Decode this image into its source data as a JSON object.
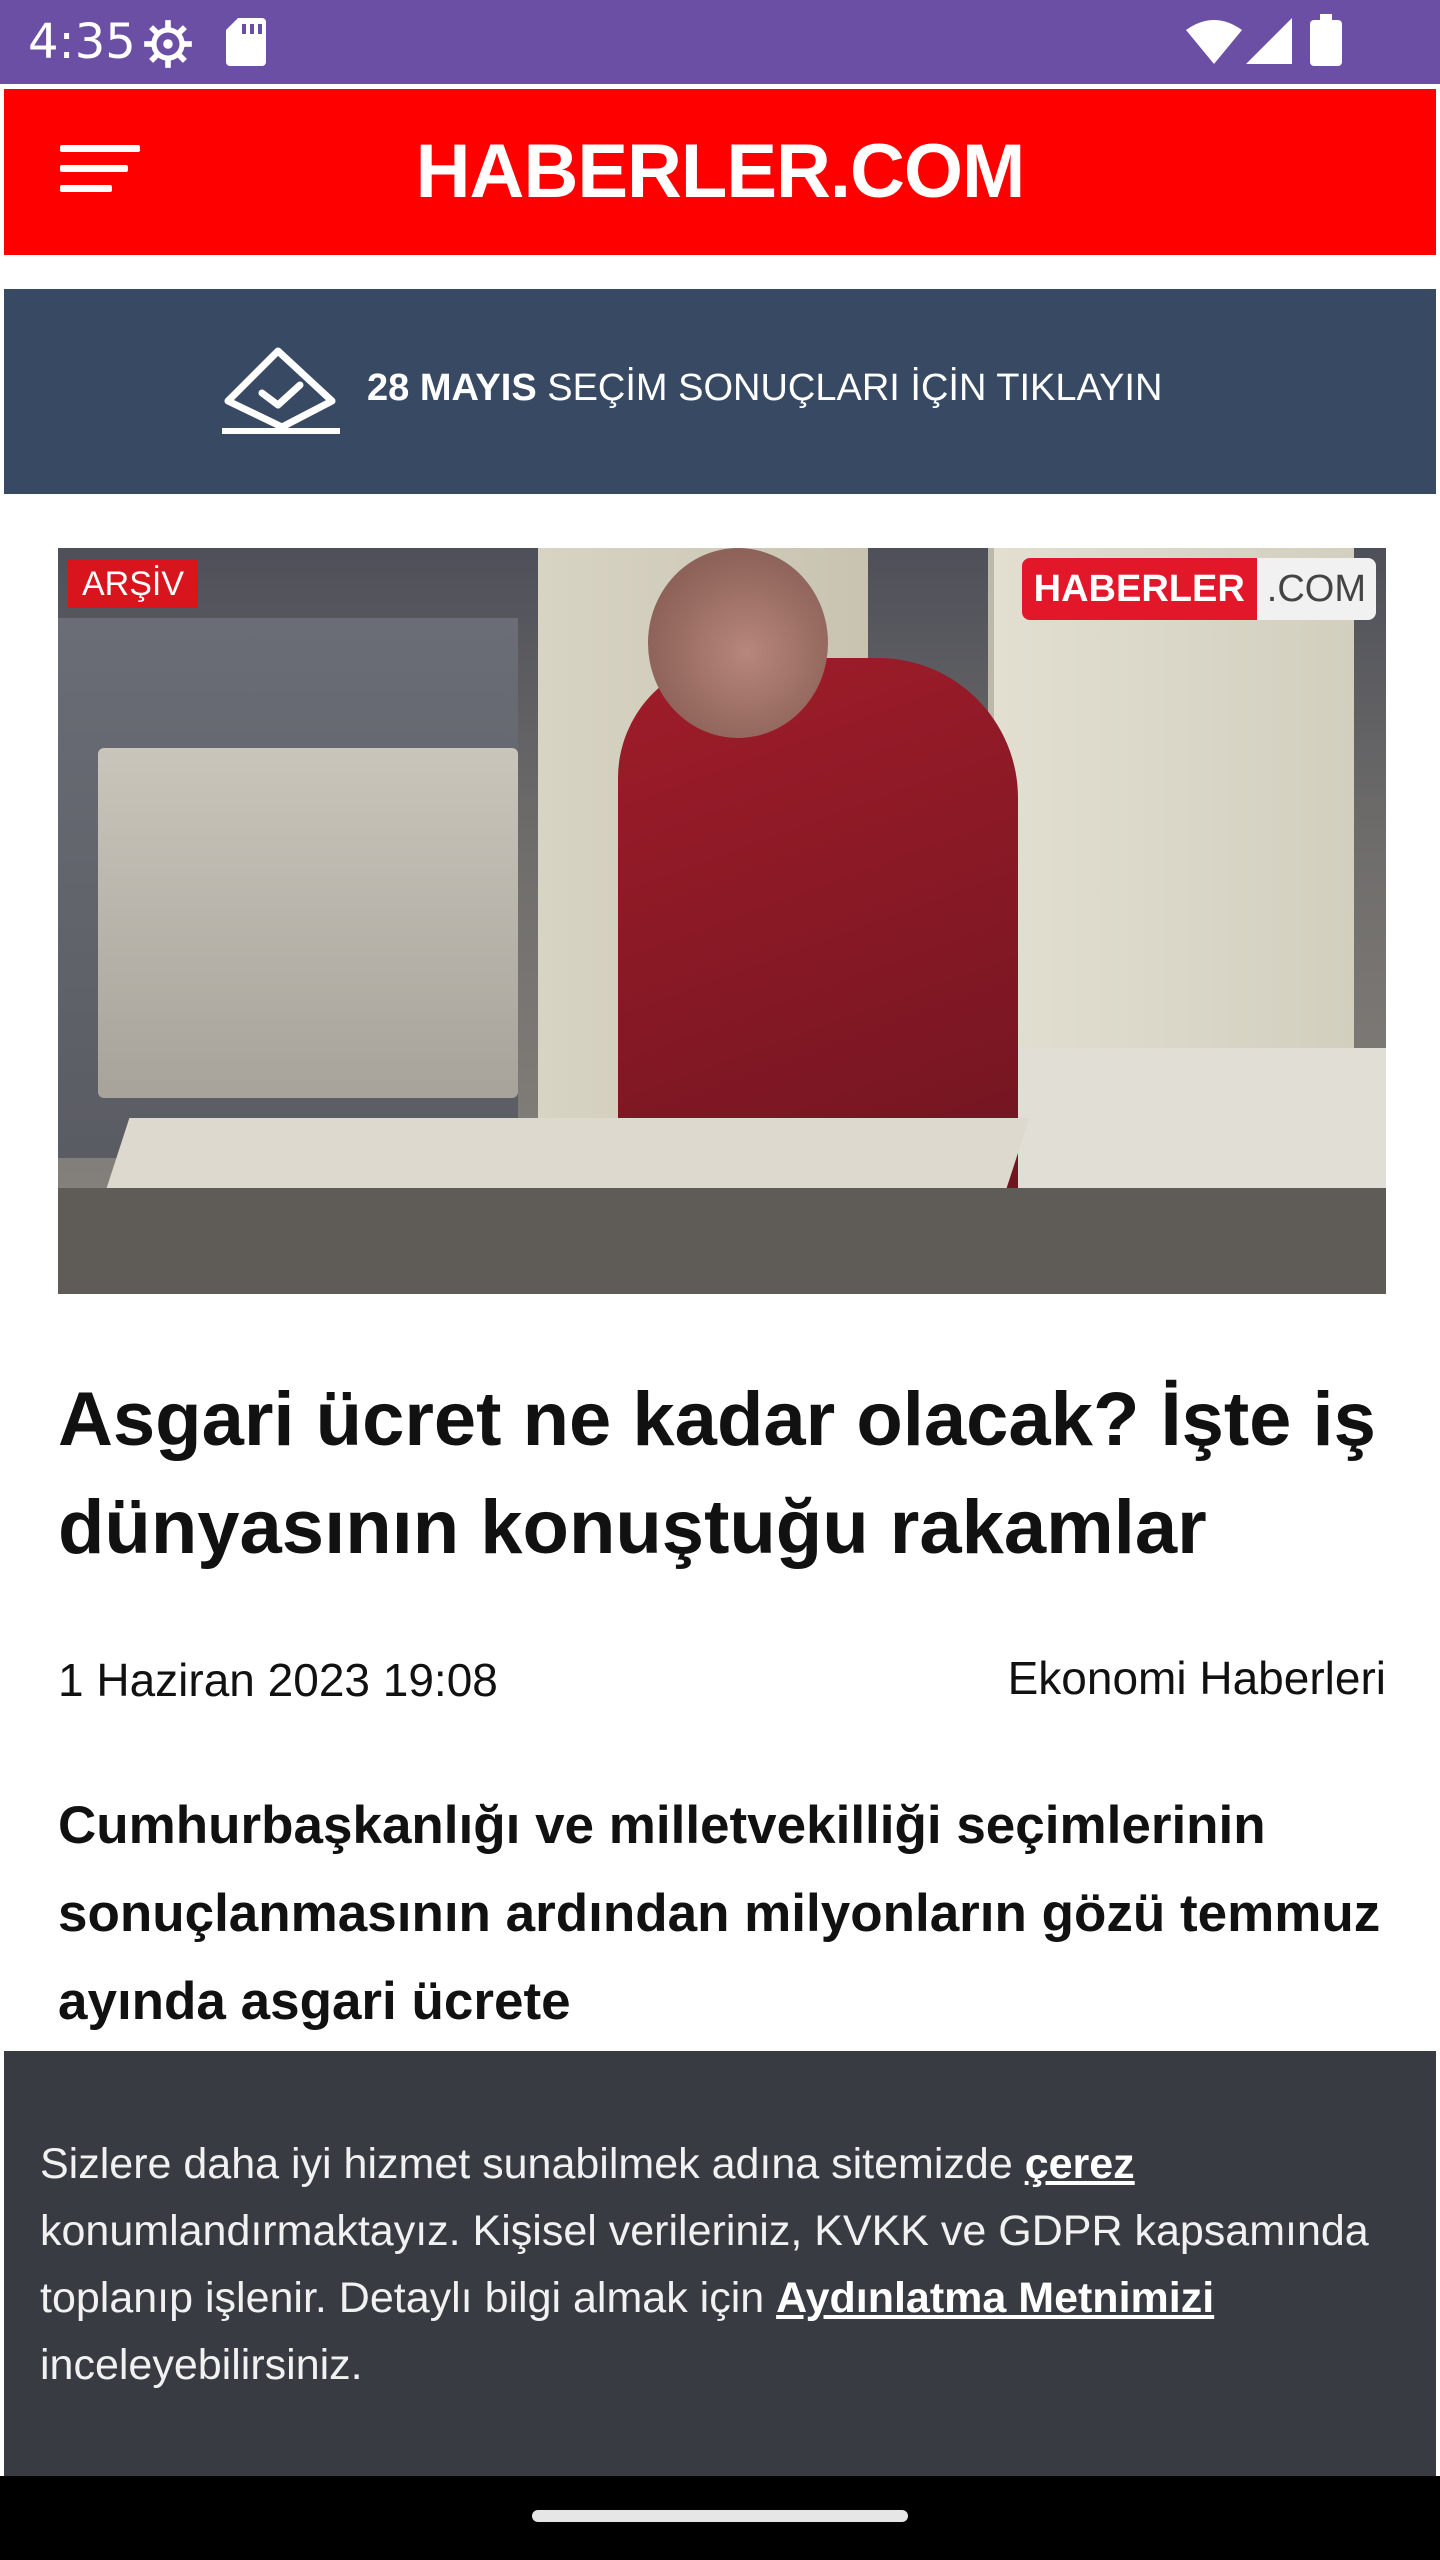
{
  "status_bar": {
    "time": "4:35",
    "icons": [
      "settings-icon",
      "sd-card-icon",
      "wifi-icon",
      "signal-icon",
      "battery-icon"
    ]
  },
  "header": {
    "logo": "HABERLER.COM",
    "menu_icon": "hamburger-menu-icon",
    "background": "#ff0000"
  },
  "election_banner": {
    "icon": "ballot-box-icon",
    "date": "28 MAYIS",
    "text": " SEÇİM SONUÇLARI İÇİN TIKLAYIN",
    "background": "#384a63"
  },
  "article": {
    "image_badge": "ARŞİV",
    "image_watermark": {
      "part1": "HABERLER",
      "part2": ".COM"
    },
    "title": "Asgari ücret ne kadar olacak? İşte iş dünyasının konuştuğu rakamlar",
    "date": "1 Haziran 2023 19:08",
    "category": "Ekonomi Haberleri",
    "lead": "Cumhurbaşkanlığı ve milletvekilliği seçimlerinin sonuçlanmasının ardından milyonların gözü temmuz ayında asgari ücrete"
  },
  "cookie_notice": {
    "text_1": "Sizlere daha iyi hizmet sunabilmek adına sitemizde ",
    "link_1": "çerez",
    "text_2": " konumlandırmaktayız. Kişisel verileriniz, KVKK ve GDPR kapsamında toplanıp işlenir. Detaylı bilgi almak için ",
    "link_2": "Aydınlatma Metnimizi",
    "text_3": " inceleyebilirsiniz.",
    "background": "#383c42"
  }
}
